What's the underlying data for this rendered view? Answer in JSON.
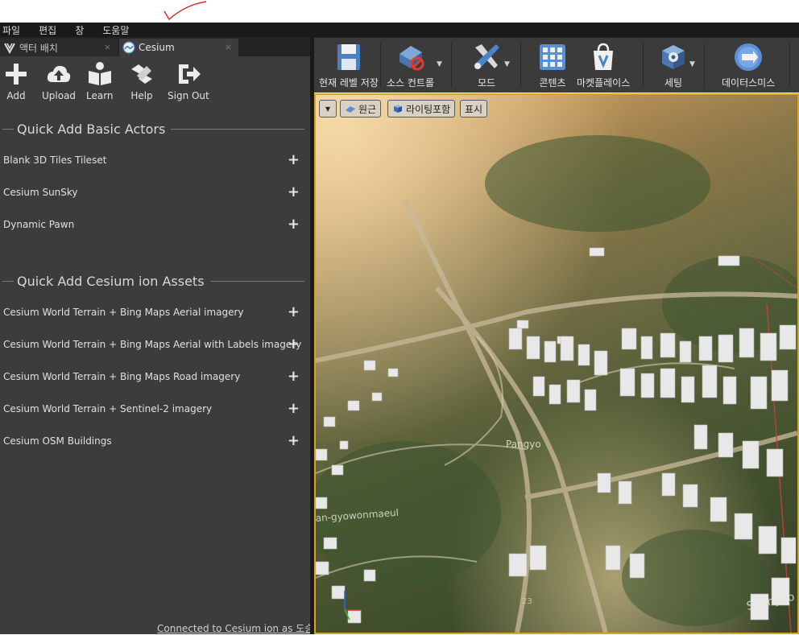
{
  "menu": [
    "파일",
    "편집",
    "창",
    "도움말"
  ],
  "tabs": [
    {
      "label": "액터 배치",
      "icon": "actor-place-icon",
      "close": "×"
    },
    {
      "label": "Cesium",
      "icon": "cesium-logo-icon",
      "close": "×"
    }
  ],
  "cesium_toolbar": [
    {
      "label": "Add",
      "icon": "plus-icon"
    },
    {
      "label": "Upload",
      "icon": "cloud-upload-icon"
    },
    {
      "label": "Learn",
      "icon": "book-icon"
    },
    {
      "label": "Help",
      "icon": "handshake-icon"
    },
    {
      "label": "Sign Out",
      "icon": "sign-out-icon"
    }
  ],
  "quick_add_basic": {
    "title": "Quick Add Basic Actors",
    "items": [
      "Blank 3D Tiles Tileset",
      "Cesium SunSky",
      "Dynamic Pawn"
    ]
  },
  "quick_add_ion": {
    "title": "Quick Add Cesium ion Assets",
    "items": [
      "Cesium World Terrain + Bing Maps Aerial imagery",
      "Cesium World Terrain + Bing Maps Aerial with Labels imagery",
      "Cesium World Terrain + Bing Maps Road imagery",
      "Cesium World Terrain + Sentinel-2 imagery",
      "Cesium OSM Buildings"
    ]
  },
  "plus_glyph": "+",
  "status": "Connected to Cesium ion as 도승이",
  "main_toolbar": [
    {
      "label": "현재 레벨 저장",
      "icon": "save-icon"
    },
    {
      "label": "소스 컨트롤",
      "icon": "source-control-icon"
    },
    {
      "label": "모드",
      "icon": "modes-icon"
    },
    {
      "label": "콘텐츠",
      "icon": "content-icon"
    },
    {
      "label": "마켓플레이스",
      "icon": "marketplace-icon"
    },
    {
      "label": "세팅",
      "icon": "settings-icon"
    },
    {
      "label": "데이터스미스",
      "icon": "datasmith-icon"
    }
  ],
  "viewport_controls": {
    "dropdown": "▾",
    "perspective": "원근",
    "lighting": "라이팅포함",
    "show": "표시"
  },
  "map_labels": [
    "Pangyo",
    "an-gyowonmaeul",
    "Seohyeo",
    "23"
  ],
  "colors": {
    "accent": "#d9a520",
    "panel": "#3c3c3c",
    "toolbar": "#3b3b3b"
  }
}
